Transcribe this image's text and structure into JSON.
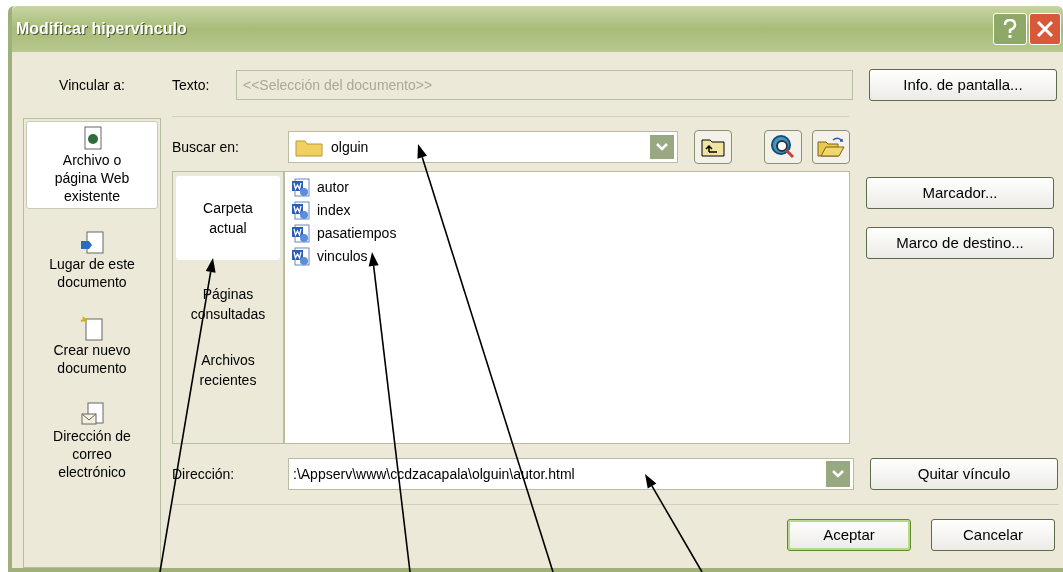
{
  "window": {
    "title": "Modificar hipervínculo"
  },
  "link_to": {
    "label": "Vincular a:",
    "items": [
      {
        "label": "Archivo o\npágina Web\nexistente",
        "kind": "file",
        "selected": true
      },
      {
        "label": "Lugar de este\ndocumento",
        "kind": "place",
        "selected": false
      },
      {
        "label": "Crear nuevo\ndocumento",
        "kind": "new",
        "selected": false
      },
      {
        "label": "Dirección de\ncorreo\nelectrónico",
        "kind": "mail",
        "selected": false
      }
    ]
  },
  "text_field": {
    "label": "Texto:",
    "value": "<<Selección del documento>>",
    "disabled": true
  },
  "look_in": {
    "label": "Buscar en:",
    "value": "olguin"
  },
  "places": [
    {
      "label": "Carpeta\nactual",
      "selected": true
    },
    {
      "label": "Páginas\nconsultadas",
      "selected": false
    },
    {
      "label": "Archivos\nrecientes",
      "selected": false
    }
  ],
  "files": [
    "autor",
    "index",
    "pasatiempos",
    "vinculos"
  ],
  "address": {
    "label": "Dirección:",
    "value": ":\\Appserv\\www\\ccdzacapala\\olguin\\autor.html"
  },
  "side_buttons": [
    "Info. de pantalla...",
    "Marcador...",
    "Marco de destino...",
    "Quitar vínculo"
  ],
  "footer_buttons": [
    {
      "label": "Aceptar",
      "default": true
    },
    {
      "label": "Cancelar",
      "default": false
    }
  ]
}
